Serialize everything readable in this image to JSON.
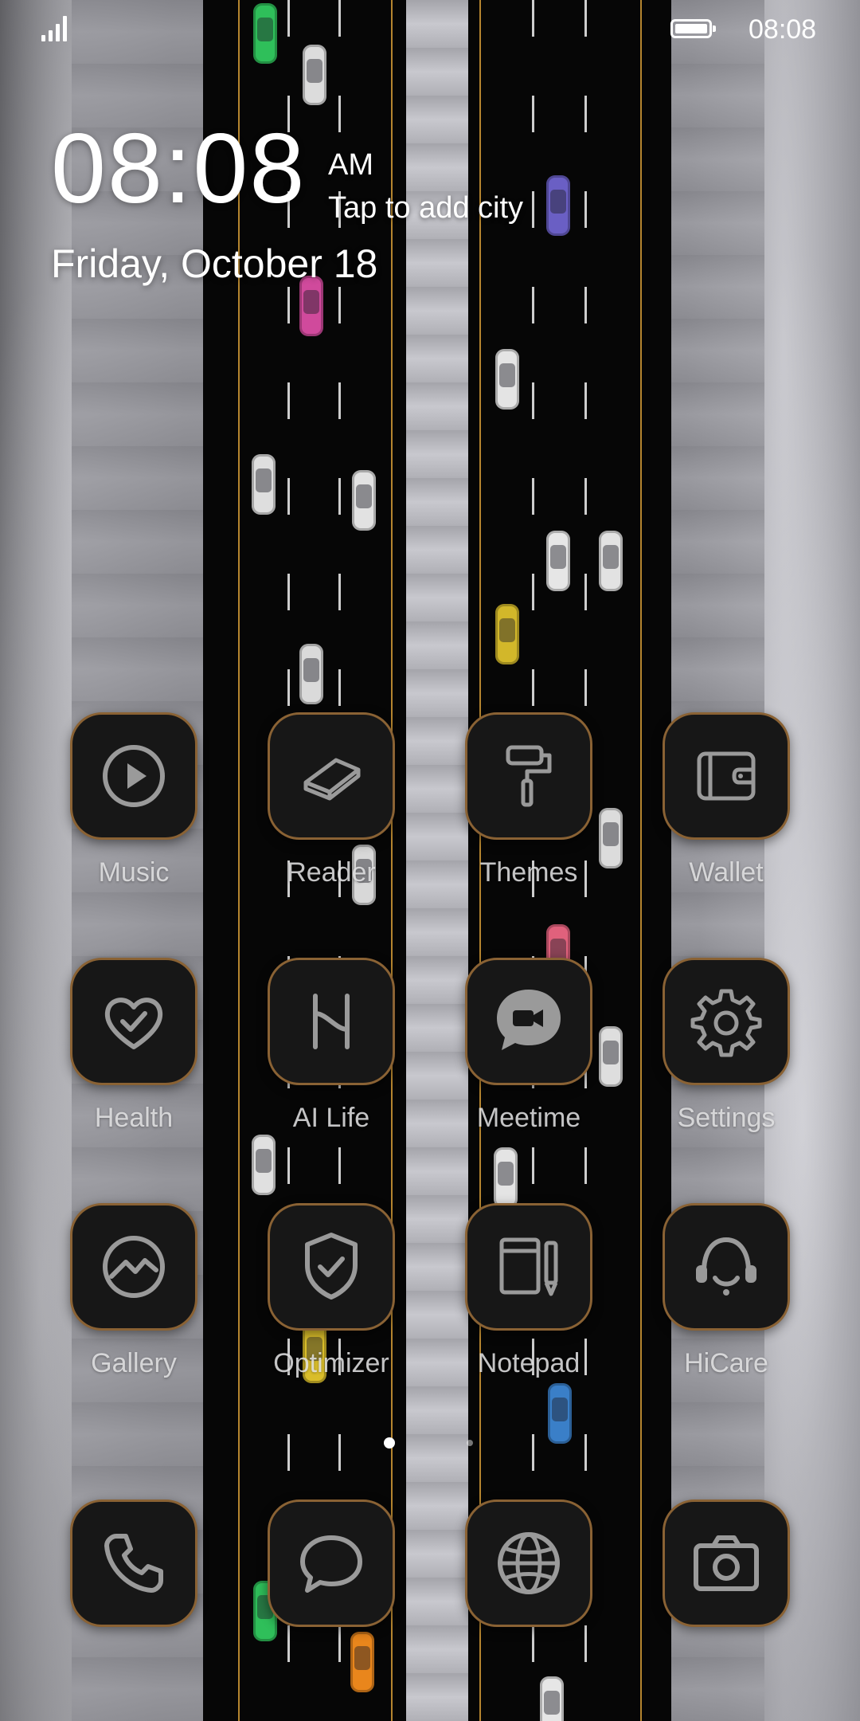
{
  "status_bar": {
    "time": "08:08",
    "signal_icon": "signal-bars-icon",
    "battery_icon": "battery-full-icon",
    "battery_level": 1.0
  },
  "clock_widget": {
    "time": "08:08",
    "ampm": "AM",
    "city_prompt": "Tap to add city",
    "date": "Friday, October 18"
  },
  "theme": {
    "tile_color": "#171717",
    "tile_border": "#8a6234",
    "icon_stroke": "#9a9a9a",
    "road_line": "#b5852f"
  },
  "apps": [
    {
      "label": "Music",
      "icon": "play-circle-icon"
    },
    {
      "label": "Reader",
      "icon": "book-icon"
    },
    {
      "label": "Themes",
      "icon": "paint-roller-icon"
    },
    {
      "label": "Wallet",
      "icon": "wallet-icon"
    },
    {
      "label": "Health",
      "icon": "heart-check-icon"
    },
    {
      "label": "AI Life",
      "icon": "ai-life-icon"
    },
    {
      "label": "Meetime",
      "icon": "video-chat-icon"
    },
    {
      "label": "Settings",
      "icon": "gear-icon"
    },
    {
      "label": "Gallery",
      "icon": "gallery-icon"
    },
    {
      "label": "Optimizer",
      "icon": "shield-check-icon"
    },
    {
      "label": "Notepad",
      "icon": "notepad-icon"
    },
    {
      "label": "HiCare",
      "icon": "headset-icon"
    }
  ],
  "dock": [
    {
      "icon": "phone-icon"
    },
    {
      "icon": "message-bubble-icon"
    },
    {
      "icon": "globe-icon"
    },
    {
      "icon": "camera-icon"
    }
  ],
  "pager": {
    "pages": 2,
    "active": 0
  }
}
